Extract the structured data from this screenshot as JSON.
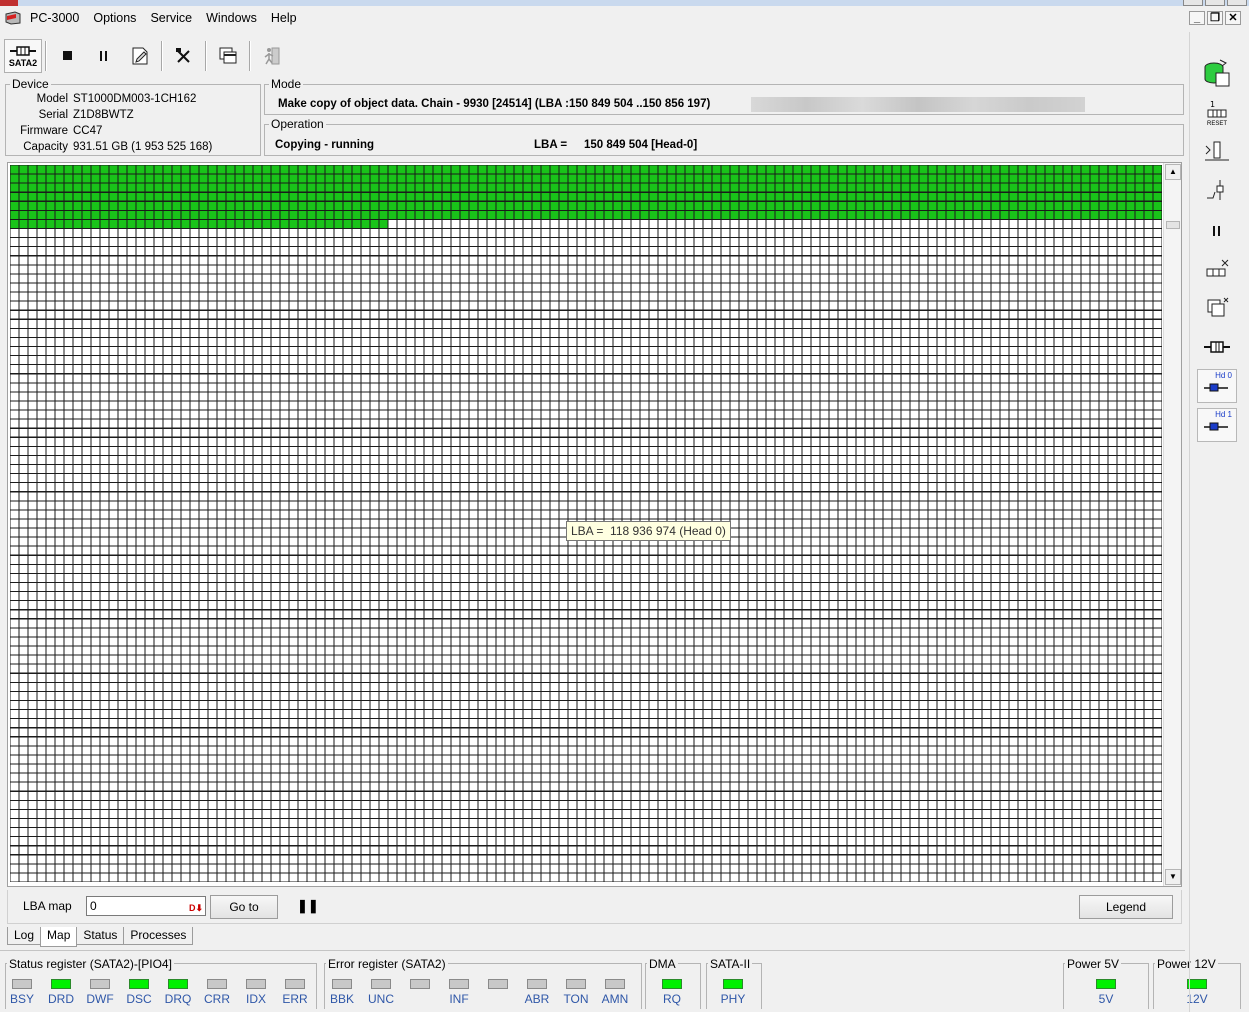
{
  "app": {
    "title": "PC-3000"
  },
  "menu": {
    "items": [
      "Options",
      "Service",
      "Windows",
      "Help"
    ]
  },
  "toolbar": {
    "sata_label": "SATA2"
  },
  "device": {
    "title": "Device",
    "model_label": "Model",
    "model": "ST1000DM003-1CH162",
    "serial_label": "Serial",
    "serial": "Z1D8BWTZ",
    "firmware_label": "Firmware",
    "firmware": "CC47",
    "capacity_label": "Capacity",
    "capacity": "931.51 GB (1 953 525 168)"
  },
  "mode": {
    "title": "Mode",
    "text": "Make copy of object data. Chain - 9930 [24514] (LBA :150 849 504 ..150 856 197)"
  },
  "operation": {
    "title": "Operation",
    "status": "Copying - running",
    "lba_label": "LBA =",
    "lba_value": "150 849 504  [Head-0]"
  },
  "map": {
    "rows": 79,
    "cols": 128,
    "filled_full_rows": 6,
    "filled_last_row_cells": 42,
    "filled_color": "#19c319",
    "empty_color": "#ffffff",
    "border_color": "#1a1a1a",
    "tooltip": "LBA =  118 936 974 (Head 0)"
  },
  "controls": {
    "lba_map_label": "LBA map",
    "lba_value": "0",
    "goto_label": "Go to",
    "legend_label": "Legend"
  },
  "tabs": [
    {
      "label": "Log",
      "active": false
    },
    {
      "label": "Map",
      "active": true
    },
    {
      "label": "Status",
      "active": false
    },
    {
      "label": "Processes",
      "active": false
    }
  ],
  "registers": {
    "status": {
      "title": "Status register (SATA2)-[PIO4]",
      "bits": [
        {
          "name": "BSY",
          "on": false
        },
        {
          "name": "DRD",
          "on": true
        },
        {
          "name": "DWF",
          "on": false
        },
        {
          "name": "DSC",
          "on": true
        },
        {
          "name": "DRQ",
          "on": true
        },
        {
          "name": "CRR",
          "on": false
        },
        {
          "name": "IDX",
          "on": false
        },
        {
          "name": "ERR",
          "on": false
        }
      ]
    },
    "error": {
      "title": "Error register (SATA2)",
      "bits": [
        {
          "name": "BBK",
          "on": false
        },
        {
          "name": "UNC",
          "on": false
        },
        {
          "name": "",
          "on": false
        },
        {
          "name": "INF",
          "on": false
        },
        {
          "name": "",
          "on": false
        },
        {
          "name": "ABR",
          "on": false
        },
        {
          "name": "TON",
          "on": false
        },
        {
          "name": "AMN",
          "on": false
        }
      ]
    },
    "dma": {
      "title": "DMA",
      "bits": [
        {
          "name": "RQ",
          "on": true
        }
      ]
    },
    "sata": {
      "title": "SATA-II",
      "bits": [
        {
          "name": "PHY",
          "on": true
        }
      ]
    },
    "power5": {
      "title": "Power 5V",
      "bits": [
        {
          "name": "5V",
          "on": true
        }
      ]
    },
    "power12": {
      "title": "Power 12V",
      "bits": [
        {
          "name": "12V",
          "on": true
        }
      ]
    }
  },
  "sidebar": {
    "hd0_label": "Hd 0",
    "hd1_label": "Hd 1",
    "reset_label": "RESET"
  },
  "colors": {
    "led_on": "#00f000",
    "led_off": "#c8c8c8",
    "register_label": "#2f57a8",
    "map_filled": "#19c319"
  }
}
